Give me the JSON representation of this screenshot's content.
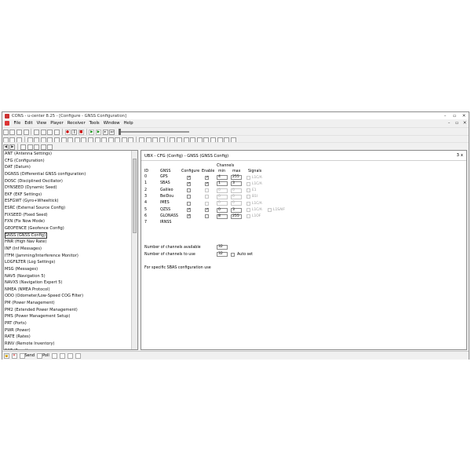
{
  "window": {
    "title": "CONS - u-center 8.25 - [Configure - GNSS Configuration]",
    "min": "–",
    "max": "▫",
    "close": "✕"
  },
  "menu": [
    "File",
    "Edit",
    "View",
    "Player",
    "Receiver",
    "Tools",
    "Window",
    "Help"
  ],
  "config_items": [
    "ANT (Antenna Settings)",
    "CFG (Configuration)",
    "DAT (Datum)",
    "DGNSS (Differential GNSS configuration)",
    "DOSC (Disciplined Oscillator)",
    "DYNSEED (Dynamic Seed)",
    "EKF (EKF Settings)",
    "ESFGWT (Gyro+Wheeltick)",
    "ESRC (External Source Config)",
    "FIXSEED (Fixed Seed)",
    "FXN (Fix Now Mode)",
    "GEOFENCE (Geofence Config)",
    "GNSS (GNSS Config)",
    "HNR (High Nav Rate)",
    "INF (Inf Messages)",
    "ITFM (Jamming/Interference Monitor)",
    "LOGFILTER (Log Settings)",
    "MSG (Messages)",
    "NAV5 (Navigation 5)",
    "NAVX5 (Navigation Expert 5)",
    "NMEA (NMEA Protocol)",
    "ODO (Odometer/Low-Speed COG Filter)",
    "PM (Power Management)",
    "PM2 (Extended Power Management)",
    "PMS (Power Management Setup)",
    "PRT (Ports)",
    "PWR (Power)",
    "RATE (Rates)",
    "RINV (Remote Inventory)",
    "RST (Reset)"
  ],
  "panel": {
    "title": "UBX - CFG (Config) - GNSS (GNSS Config)",
    "close": "3 x",
    "headers": {
      "channels": "Channels",
      "id": "ID",
      "gnss": "GNSS",
      "configure": "Configure",
      "enable": "Enable",
      "min": "min",
      "max": "max",
      "signals": "Signals"
    },
    "rows": [
      {
        "id": "0",
        "gnss": "GPS",
        "configure": "✓",
        "enable": "✓",
        "min": "4",
        "max": "255",
        "signals": [
          "L1C/A"
        ]
      },
      {
        "id": "1",
        "gnss": "SBAS",
        "configure": "✓",
        "enable": "✓",
        "min": "1",
        "max": "3",
        "signals": [
          "L1C/A"
        ]
      },
      {
        "id": "2",
        "gnss": "Galileo",
        "configure": "",
        "enable": "",
        "min": "0",
        "max": "0",
        "signals": [
          "E1"
        ]
      },
      {
        "id": "3",
        "gnss": "BeiDou",
        "configure": "",
        "enable": "",
        "min": "0",
        "max": "0",
        "signals": [
          "B1I"
        ]
      },
      {
        "id": "4",
        "gnss": "IMES",
        "configure": "",
        "enable": "",
        "min": "0",
        "max": "0",
        "signals": [
          "L1C/A"
        ]
      },
      {
        "id": "5",
        "gnss": "QZSS",
        "configure": "✓",
        "enable": "✓",
        "min": "0",
        "max": "3",
        "signals": [
          "L1C/A",
          "L1SAIF"
        ]
      },
      {
        "id": "6",
        "gnss": "GLONASS",
        "configure": "✓",
        "enable": "",
        "min": "8",
        "max": "255",
        "signals": [
          "L1OF"
        ]
      },
      {
        "id": "7",
        "gnss": "IRNSS"
      }
    ],
    "channels_available_label": "Number of channels available",
    "channels_available": "32",
    "channels_to_use_label": "Number of channels to use",
    "channels_to_use": "32",
    "auto_set": "Auto set",
    "note": "For specific SBAS configuration use"
  },
  "status": {
    "send": "Send",
    "poll": "Poll"
  }
}
